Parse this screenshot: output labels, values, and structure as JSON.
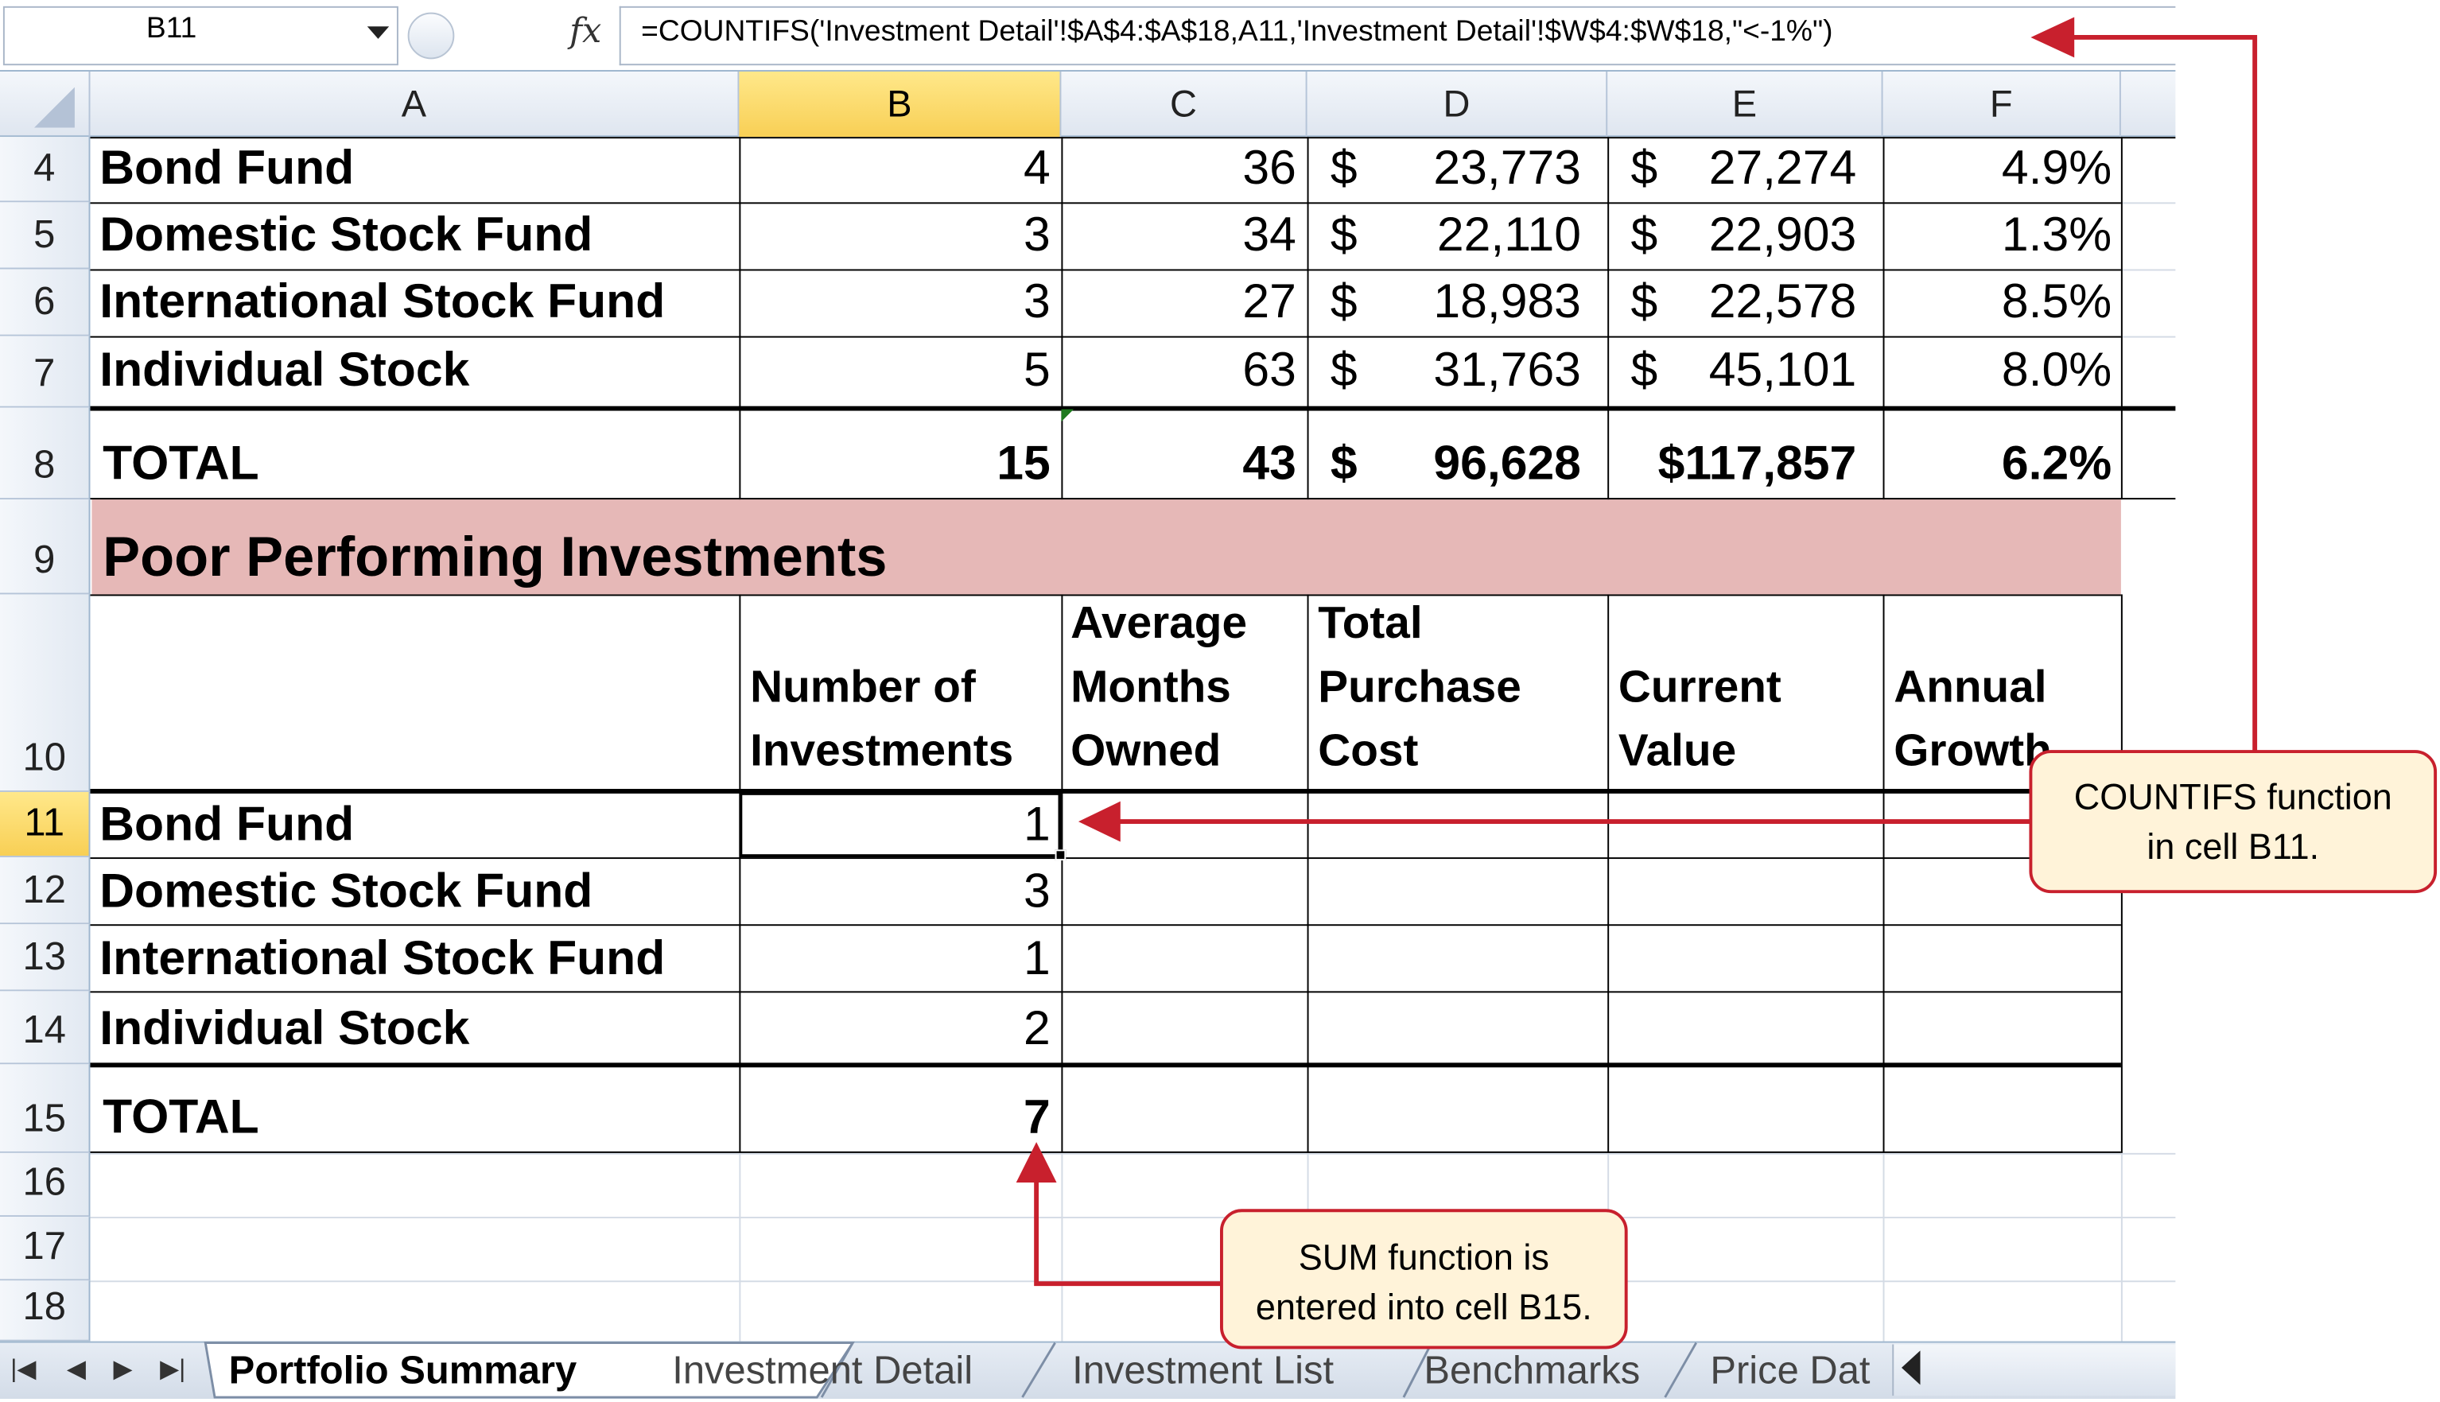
{
  "formula_bar": {
    "name_box": "B11",
    "formula": "=COUNTIFS('Investment Detail'!$A$4:$A$18,A11,'Investment Detail'!$W$4:$W$18,\"<-1%\")"
  },
  "columns": [
    "A",
    "B",
    "C",
    "D",
    "E",
    "F"
  ],
  "rows_upper": [
    {
      "row": "4",
      "a": "Bond Fund",
      "b": "4",
      "c": "36",
      "d_sym": "$",
      "d": "23,773",
      "e_sym": "$",
      "e": "27,274",
      "f": "4.9%"
    },
    {
      "row": "5",
      "a": "Domestic Stock Fund",
      "b": "3",
      "c": "34",
      "d_sym": "$",
      "d": "22,110",
      "e_sym": "$",
      "e": "22,903",
      "f": "1.3%"
    },
    {
      "row": "6",
      "a": "International Stock Fund",
      "b": "3",
      "c": "27",
      "d_sym": "$",
      "d": "18,983",
      "e_sym": "$",
      "e": "22,578",
      "f": "8.5%"
    },
    {
      "row": "7",
      "a": "Individual Stock",
      "b": "5",
      "c": "63",
      "d_sym": "$",
      "d": "31,763",
      "e_sym": "$",
      "e": "45,101",
      "f": "8.0%"
    }
  ],
  "total_upper": {
    "row": "8",
    "a": "TOTAL",
    "b": "15",
    "c": "43",
    "d_sym": "$",
    "d": "96,628",
    "e": "$117,857",
    "f": "6.2%"
  },
  "section": {
    "row": "9",
    "title": "Poor Performing Investments"
  },
  "header_row": {
    "row": "10",
    "b": [
      "Number of",
      "Investments"
    ],
    "c": [
      "Average",
      "Months",
      "Owned"
    ],
    "d": [
      "Total",
      "Purchase",
      "Cost"
    ],
    "e": [
      "Current",
      "Value"
    ],
    "f": [
      "Annual",
      "Growth"
    ]
  },
  "rows_lower": [
    {
      "row": "11",
      "a": "Bond Fund",
      "b": "1"
    },
    {
      "row": "12",
      "a": "Domestic Stock Fund",
      "b": "3"
    },
    {
      "row": "13",
      "a": "International Stock Fund",
      "b": "1"
    },
    {
      "row": "14",
      "a": "Individual Stock",
      "b": "2"
    }
  ],
  "total_lower": {
    "row": "15",
    "a": "TOTAL",
    "b": "7"
  },
  "empty_rows": [
    "16",
    "17",
    "18"
  ],
  "tabs": [
    "Portfolio Summary",
    "Investment Detail",
    "Investment List",
    "Benchmarks",
    "Price Dat"
  ],
  "callouts": {
    "countifs": [
      "COUNTIFS function",
      "in cell B11."
    ],
    "sum": [
      "SUM function is",
      "entered into cell B15."
    ]
  },
  "colors": {
    "callout_border": "#c8202d",
    "callout_fill": "#fff3d9",
    "band": "#e6b8b7",
    "selected_header": "#f8cf55"
  }
}
